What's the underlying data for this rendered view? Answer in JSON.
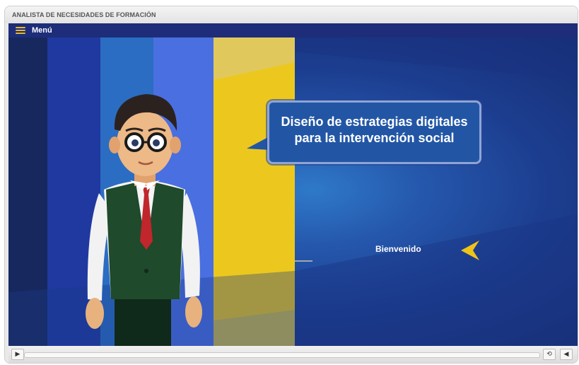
{
  "window": {
    "title": "ANALISTA DE NECESIDADES DE FORMACIÓN"
  },
  "menubar": {
    "menu_label": "Menú",
    "menu_icon": "hamburger-icon",
    "accent_color": "#e7b92c"
  },
  "slide": {
    "bubble_line1": "Diseño de estrategias digitales",
    "bubble_line2": "para la intervención social",
    "welcome_text": "Bienvenido",
    "arrow_color": "#f0c318"
  },
  "player": {
    "play_icon": "play-icon",
    "replay_icon": "replay-icon",
    "volume_icon": "volume-icon",
    "progress": 0
  }
}
